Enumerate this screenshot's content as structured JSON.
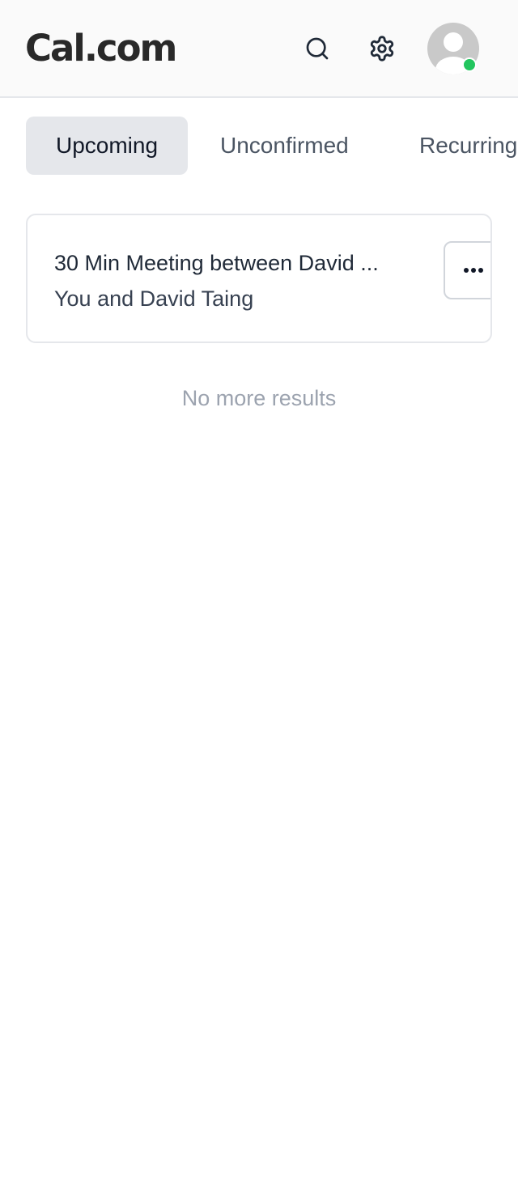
{
  "header": {
    "logo": "Cal.com",
    "search_icon": "search-icon",
    "settings_icon": "gear-icon",
    "avatar_status_color": "#22c55e"
  },
  "tabs": [
    {
      "label": "Upcoming",
      "active": true
    },
    {
      "label": "Unconfirmed",
      "active": false
    },
    {
      "label": "Recurring",
      "active": false
    }
  ],
  "bookings": [
    {
      "title": "30 Min Meeting between David ...",
      "attendees": "You and David Taing",
      "menu_icon": "more-horizontal-icon"
    }
  ],
  "list_end_message": "No more results"
}
